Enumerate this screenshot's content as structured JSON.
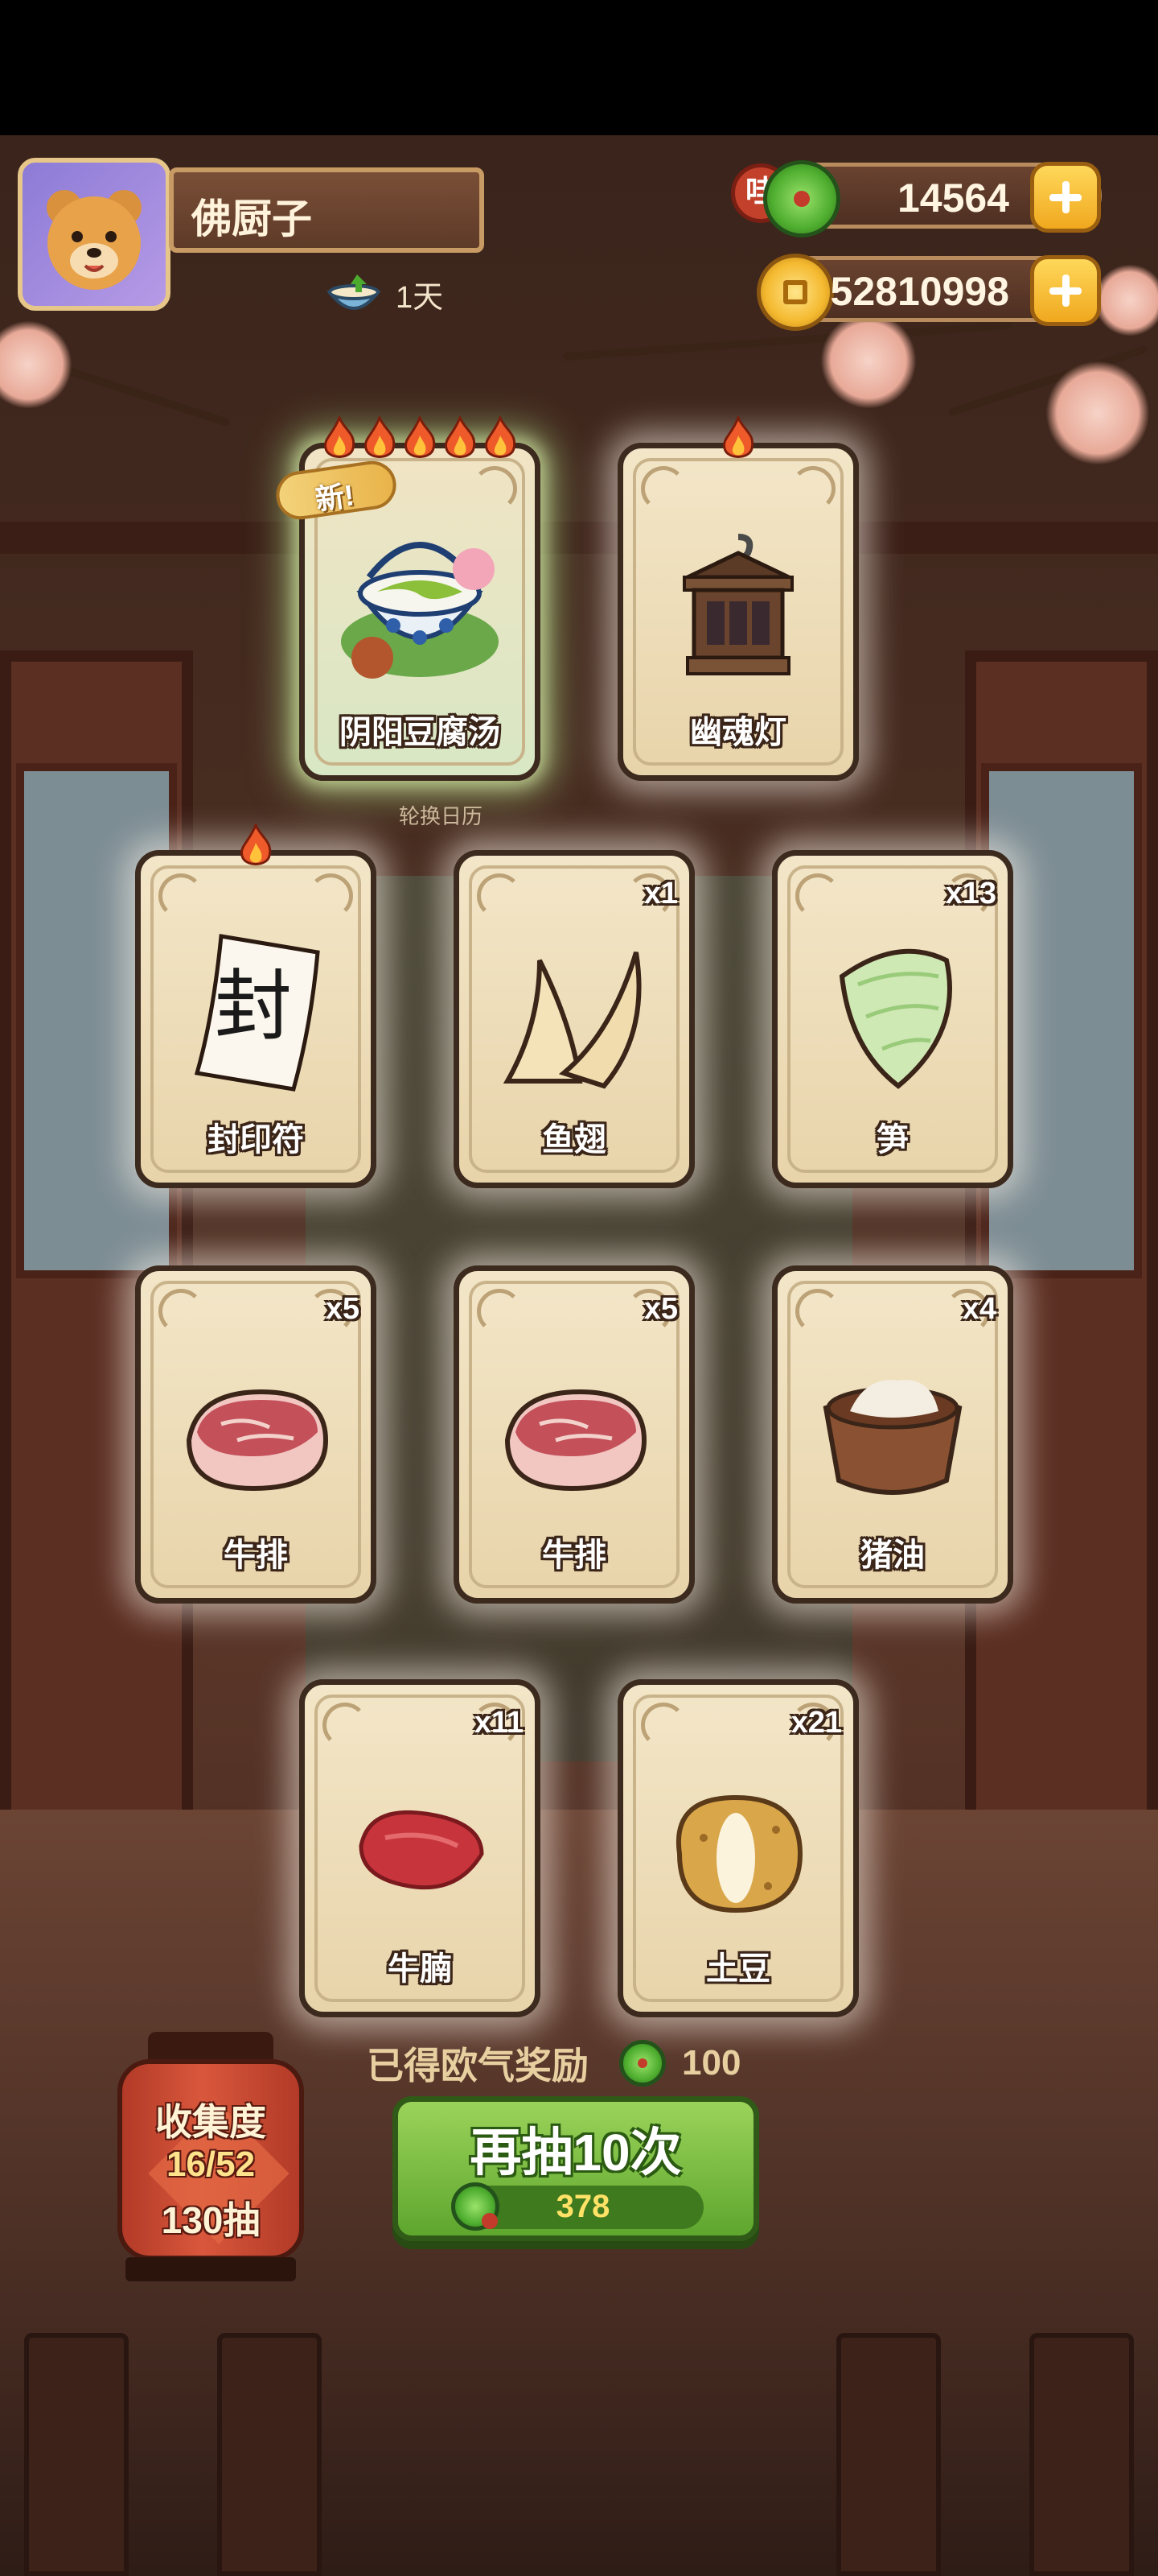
{
  "player": {
    "name": "佛厨子",
    "days": "1天"
  },
  "currency": {
    "jade_badge": "哇",
    "jade_amount": "14564",
    "gold_amount": "52810998"
  },
  "board_caption": "轮换日历",
  "cards_top": [
    {
      "label": "阴阳豆腐汤",
      "flames": 5,
      "new_tag": "新!",
      "special": true
    },
    {
      "label": "幽魂灯",
      "flames": 1
    }
  ],
  "cards_row2": [
    {
      "label": "封印符",
      "flames": 1,
      "glyph": "封"
    },
    {
      "label": "鱼翅",
      "count": "x1"
    },
    {
      "label": "笋",
      "count": "x13"
    }
  ],
  "cards_row3": [
    {
      "label": "牛排",
      "count": "x5"
    },
    {
      "label": "牛排",
      "count": "x5"
    },
    {
      "label": "猪油",
      "count": "x4"
    }
  ],
  "cards_row4": [
    {
      "label": "牛腩",
      "count": "x11"
    },
    {
      "label": "土豆",
      "count": "x21"
    }
  ],
  "reward": {
    "text": "已得欧气奖励",
    "amount": "100"
  },
  "draw_button": {
    "label": "再抽10次",
    "cost": "378"
  },
  "collection": {
    "title": "收集度",
    "progress": "16/52",
    "draws": "130抽"
  }
}
